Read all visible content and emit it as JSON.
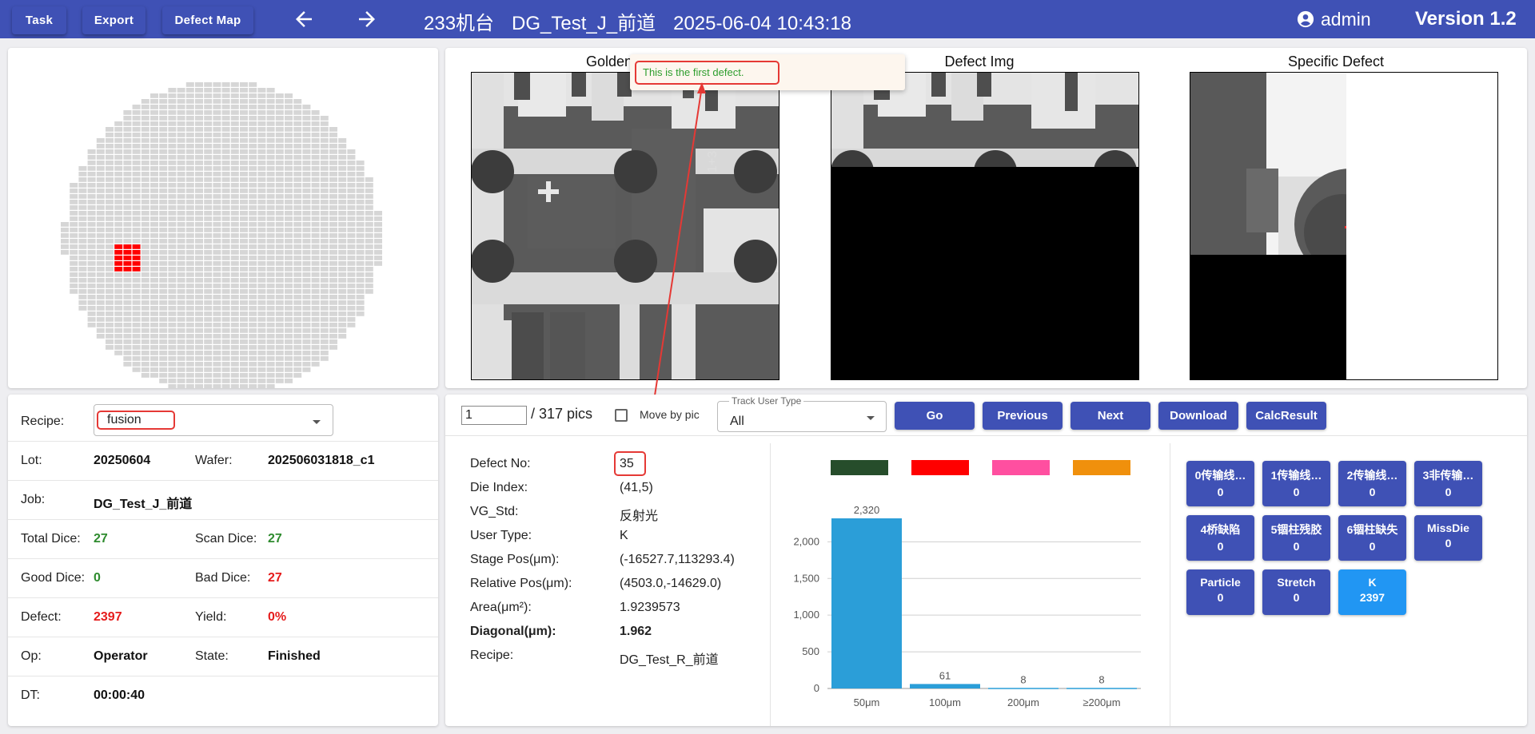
{
  "toolbar": {
    "task_label": "Task",
    "export_label": "Export",
    "defect_map_label": "Defect Map"
  },
  "header": {
    "machine": "233机台",
    "job": "DG_Test_J_前道",
    "datetime": "2025-06-04 10:43:18",
    "user": "admin",
    "version": "Version 1.2"
  },
  "images": {
    "golden_title": "Golden",
    "defect_title": "Defect Img",
    "specific_title": "Specific Defect",
    "tooltip": "This is the first defect."
  },
  "info": {
    "recipe_label": "Recipe:",
    "recipe_value": "fusion",
    "lot_label": "Lot:",
    "lot_value": "20250604",
    "wafer_label": "Wafer:",
    "wafer_value": "202506031818_c1",
    "job_label": "Job:",
    "job_value": "DG_Test_J_前道",
    "total_dice_label": "Total Dice:",
    "total_dice_value": "27",
    "scan_dice_label": "Scan Dice:",
    "scan_dice_value": "27",
    "good_dice_label": "Good Dice:",
    "good_dice_value": "0",
    "bad_dice_label": "Bad Dice:",
    "bad_dice_value": "27",
    "defect_label": "Defect:",
    "defect_value": "2397",
    "yield_label": "Yield:",
    "yield_value": "0%",
    "op_label": "Op:",
    "op_value": "Operator",
    "state_label": "State:",
    "state_value": "Finished",
    "dt_label": "DT:",
    "dt_value": "00:00:40"
  },
  "controls": {
    "pic_index": "1",
    "pic_total": "/ 317 pics",
    "move_by_pic_label": "Move by pic",
    "move_by_pic_checked": false,
    "track_label": "Track User Type",
    "track_value": "All",
    "go_label": "Go",
    "previous_label": "Previous",
    "next_label": "Next",
    "download_label": "Download",
    "calc_label": "CalcResult"
  },
  "defect": {
    "no_label": "Defect No:",
    "no_value": "35",
    "die_index_label": "Die Index:",
    "die_index_value": "(41,5)",
    "vg_std_label": "VG_Std:",
    "vg_std_value": "反射光",
    "user_type_label": "User Type:",
    "user_type_value": "K",
    "stage_pos_label": "Stage Pos(μm):",
    "stage_pos_value": "(-16527.7,113293.4)",
    "relative_pos_label": "Relative Pos(μm):",
    "relative_pos_value": "(4503.0,-14629.0)",
    "area_label": "Area(μm²):",
    "area_value": "1.9239573",
    "diagonal_label": "Diagonal(μm):",
    "diagonal_value": "1.962",
    "recipe_label": "Recipe:",
    "recipe_value": "DG_Test_R_前道"
  },
  "chart_data": {
    "type": "bar",
    "categories": [
      "50μm",
      "100μm",
      "200μm",
      "≥200μm"
    ],
    "values": [
      2320,
      61,
      8,
      8
    ],
    "value_labels": [
      "2,320",
      "61",
      "8",
      "8"
    ],
    "yticks": [
      "0",
      "500",
      "1,000",
      "1,500",
      "2,000"
    ],
    "ylim": [
      0,
      2200
    ],
    "bar_color": "#2b9ed8",
    "legend_colors": [
      "#264d2b",
      "#ff0000",
      "#ff4fa0",
      "#f0900c"
    ]
  },
  "categories": [
    {
      "name": "0传输线…",
      "count": "0"
    },
    {
      "name": "1传输线…",
      "count": "0"
    },
    {
      "name": "2传输线…",
      "count": "0"
    },
    {
      "name": "3非传输…",
      "count": "0"
    },
    {
      "name": "4桥缺陷",
      "count": "0"
    },
    {
      "name": "5锢柱残胶",
      "count": "0"
    },
    {
      "name": "6锢柱缺失",
      "count": "0"
    },
    {
      "name": "MissDie",
      "count": "0"
    },
    {
      "name": "Particle",
      "count": "0"
    },
    {
      "name": "Stretch",
      "count": "0"
    },
    {
      "name": "K",
      "count": "2397"
    }
  ],
  "colors": {
    "brand": "#3f51b5",
    "active": "#2196f3",
    "good": "#2e8b2e",
    "bad": "#e51c1c"
  }
}
